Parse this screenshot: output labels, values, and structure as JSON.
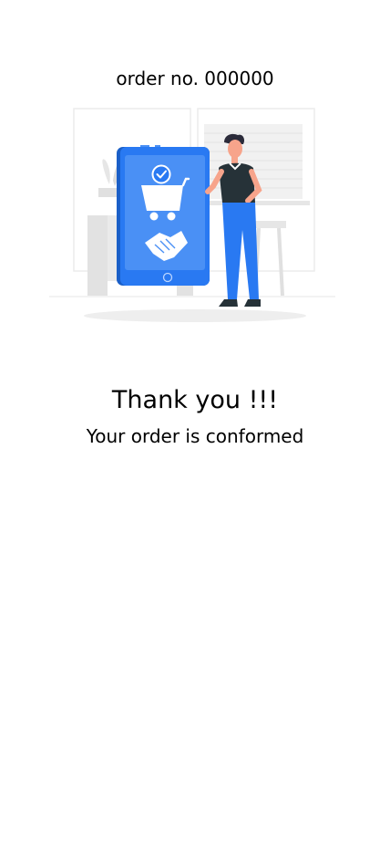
{
  "order": {
    "number_label": "order no. 000000"
  },
  "illustration": {
    "name": "order-confirmed-illustration",
    "accent_color": "#2979f2",
    "icons": [
      "shopping-cart-icon",
      "check-icon",
      "handshake-icon"
    ]
  },
  "confirmation": {
    "title": "Thank you !!!",
    "subtitle": "Your order is conformed"
  }
}
